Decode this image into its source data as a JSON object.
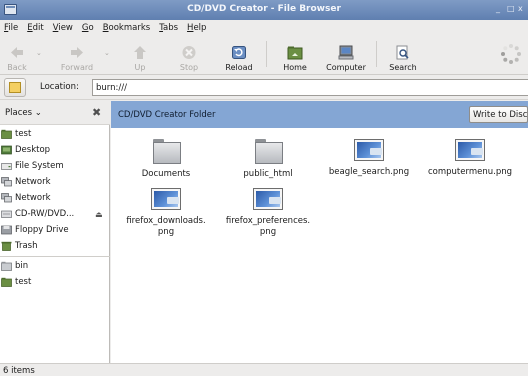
{
  "window": {
    "title": "CD/DVD Creator - File Browser",
    "controls": [
      "_",
      "□",
      "x"
    ]
  },
  "menubar": {
    "items": [
      {
        "label": "File",
        "mnemonic": "F"
      },
      {
        "label": "Edit",
        "mnemonic": "E"
      },
      {
        "label": "View",
        "mnemonic": "V"
      },
      {
        "label": "Go",
        "mnemonic": "G"
      },
      {
        "label": "Bookmarks",
        "mnemonic": "B"
      },
      {
        "label": "Tabs",
        "mnemonic": "T"
      },
      {
        "label": "Help",
        "mnemonic": "H"
      }
    ]
  },
  "toolbar": {
    "back": {
      "label": "Back",
      "icon": "back-arrow-icon",
      "enabled": false
    },
    "forward": {
      "label": "Forward",
      "icon": "forward-arrow-icon",
      "enabled": false
    },
    "up": {
      "label": "Up",
      "icon": "up-arrow-icon",
      "enabled": false
    },
    "stop": {
      "label": "Stop",
      "icon": "stop-icon",
      "enabled": false
    },
    "reload": {
      "label": "Reload",
      "icon": "reload-icon",
      "enabled": true
    },
    "home": {
      "label": "Home",
      "icon": "home-folder-icon",
      "enabled": true
    },
    "computer": {
      "label": "Computer",
      "icon": "computer-icon",
      "enabled": true
    },
    "search": {
      "label": "Search",
      "icon": "search-icon",
      "enabled": true
    }
  },
  "location": {
    "label": "Location:",
    "value": "burn:///"
  },
  "sidebar": {
    "header": "Places",
    "items": [
      {
        "label": "test",
        "icon": "home-folder-icon"
      },
      {
        "label": "Desktop",
        "icon": "desktop-icon"
      },
      {
        "label": "File System",
        "icon": "drive-icon"
      },
      {
        "label": "Network",
        "icon": "network-icon"
      },
      {
        "label": "Network",
        "icon": "network-icon"
      },
      {
        "label": "CD-RW/DVD...",
        "icon": "optical-drive-icon"
      },
      {
        "label": "Floppy Drive",
        "icon": "floppy-icon"
      },
      {
        "label": "Trash",
        "icon": "trash-icon"
      }
    ],
    "bookmarks": [
      {
        "label": "bin",
        "icon": "folder-icon"
      },
      {
        "label": "test",
        "icon": "home-folder-icon"
      }
    ]
  },
  "main": {
    "header": "CD/DVD Creator Folder",
    "write_button": "Write to Disc",
    "files": [
      {
        "name": "Documents",
        "type": "folder"
      },
      {
        "name": "public_html",
        "type": "folder"
      },
      {
        "name": "beagle_search.png",
        "type": "image"
      },
      {
        "name": "computermenu.png",
        "type": "image"
      },
      {
        "name": "firefox_downloads.\npng",
        "type": "image"
      },
      {
        "name": "firefox_preferences.\npng",
        "type": "image"
      }
    ]
  },
  "status": {
    "text": "6 items"
  }
}
